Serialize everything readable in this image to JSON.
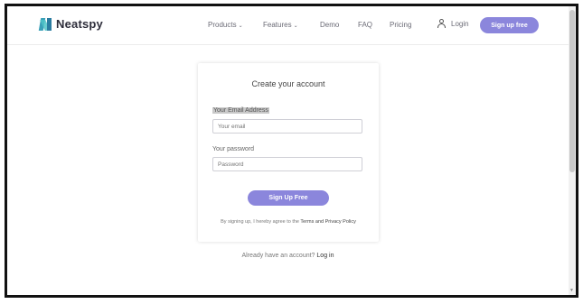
{
  "header": {
    "brand": "Neatspy",
    "nav": [
      {
        "label": "Products",
        "has_dropdown": true
      },
      {
        "label": "Features",
        "has_dropdown": true
      },
      {
        "label": "Demo",
        "has_dropdown": false
      },
      {
        "label": "FAQ",
        "has_dropdown": false
      },
      {
        "label": "Pricing",
        "has_dropdown": false
      }
    ],
    "login_label": "Login",
    "signup_label": "Sign up free",
    "chevron": "⌄"
  },
  "form": {
    "title": "Create your account",
    "email_label": "Your Email Address",
    "email_placeholder": "Your email",
    "password_label": "Your password",
    "password_placeholder": "Password",
    "submit_label": "Sign Up Free",
    "terms_prefix": "By signing up, I hereby agree to the",
    "terms_link": "Terms and Privacy Policy"
  },
  "footer": {
    "already_text": "Already have an account?",
    "login_link": "Log in"
  },
  "colors": {
    "accent": "#8b86dc",
    "brand_teal": "#3aa0b8"
  }
}
